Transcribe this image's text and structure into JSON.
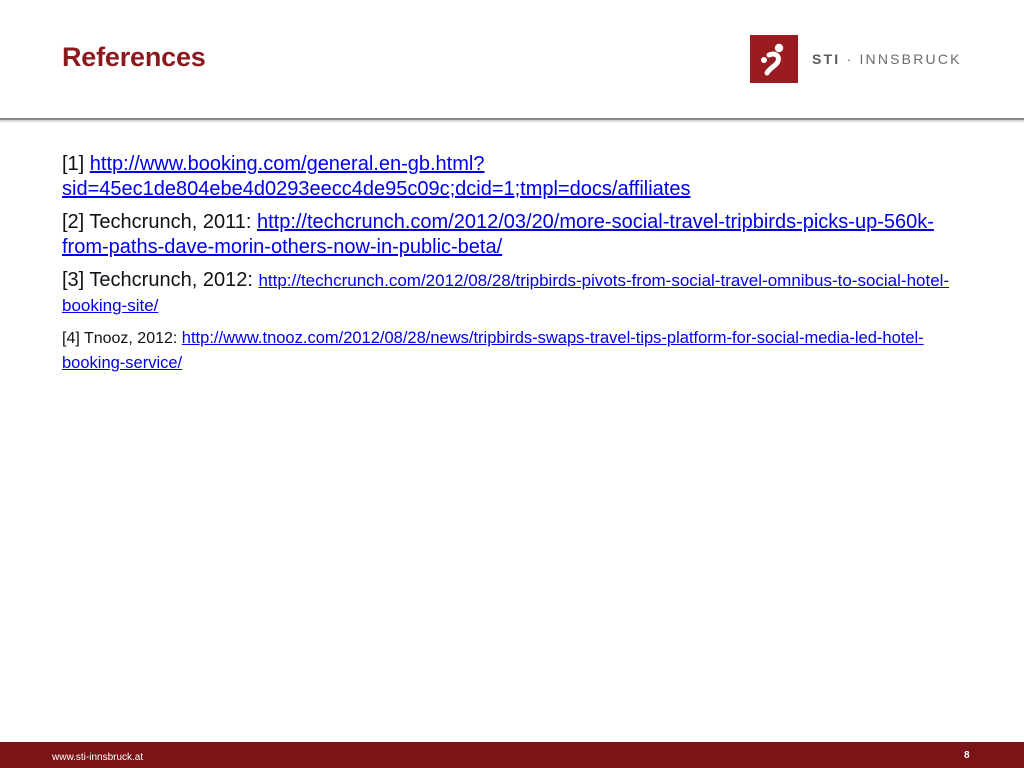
{
  "title": "References",
  "logo": {
    "name_bold": "STI",
    "separator": " · ",
    "name_rest": "INNSBRUCK",
    "brand_color": "#9b1c20"
  },
  "references": [
    {
      "label": "[1] ",
      "link": "http://www.booking.com/general.en-gb.html?sid=45ec1de804ebe4d0293eecc4de95c09c;dcid=1;tmpl=docs/affiliates"
    },
    {
      "label": "[2] Techcrunch, 2011: ",
      "link": "http://techcrunch.com/2012/03/20/more-social-travel-tripbirds-picks-up-560k-from-paths-dave-morin-others-now-in-public-beta/"
    },
    {
      "label": "[3] Techcrunch, 2012: ",
      "link": "http://techcrunch.com/2012/08/28/tripbirds-pivots-from-social-travel-omnibus-to-social-hotel-booking-site/"
    },
    {
      "label": "[4] Tnooz, 2012: ",
      "link": "http://www.tnooz.com/2012/08/28/news/tripbirds-swaps-travel-tips-platform-for-social-media-led-hotel-booking-service/"
    }
  ],
  "footer": {
    "url": "www.sti-innsbruck.at",
    "page_number": "8",
    "color": "#7a1417"
  },
  "colors": {
    "title": "#8b1a1e",
    "link": "#0000ee"
  }
}
